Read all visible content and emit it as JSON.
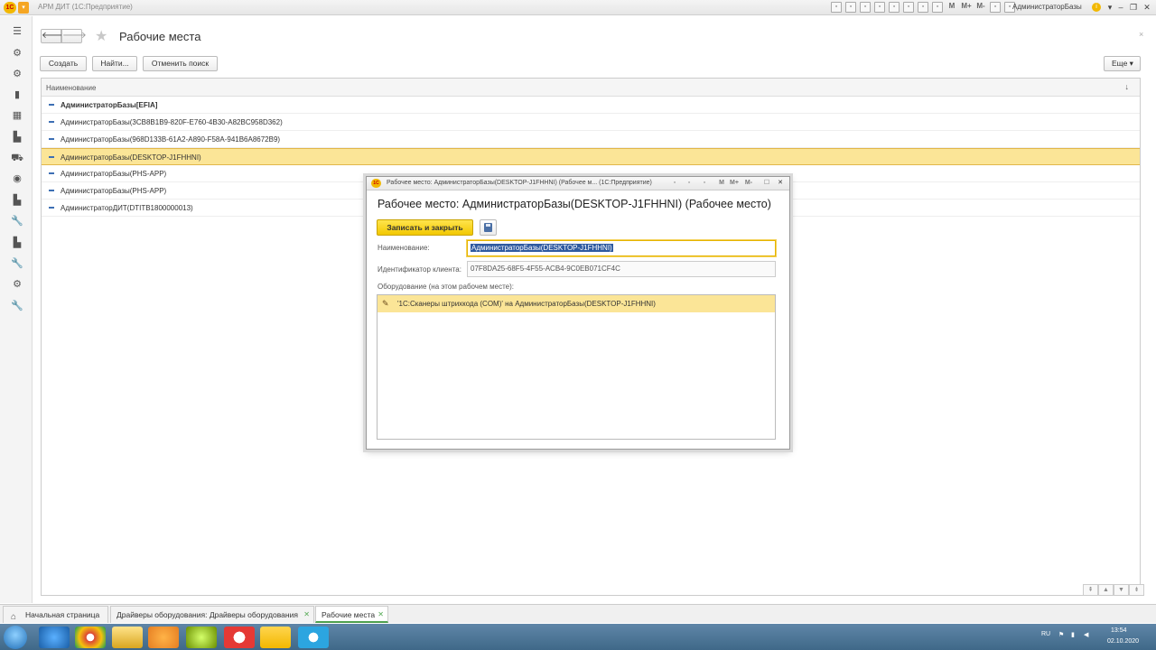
{
  "window": {
    "title": "АРМ ДИТ  (1С:Предприятие)",
    "user": "АдминистраторБазы",
    "toolbar_items": [
      "M",
      "M+",
      "M-"
    ]
  },
  "page": {
    "title": "Рабочие места",
    "buttons": {
      "create": "Создать",
      "find": "Найти...",
      "cancel_search": "Отменить поиск",
      "more": "Еще"
    }
  },
  "table": {
    "column_header": "Наименование",
    "rows": [
      {
        "name": "АдминистраторБазы[EFIA]",
        "bold": true,
        "selected": false
      },
      {
        "name": "АдминистраторБазы(3CB8B1B9-820F-E760-4B30-A82BC958D362)",
        "bold": false,
        "selected": false
      },
      {
        "name": "АдминистраторБазы(968D133B-61A2-A890-F58A-941B6A8672B9)",
        "bold": false,
        "selected": false
      },
      {
        "name": "АдминистраторБазы(DESKTOP-J1FHHNI)",
        "bold": false,
        "selected": true
      },
      {
        "name": "АдминистраторБазы(PHS-APP)",
        "bold": false,
        "selected": false
      },
      {
        "name": "АдминистраторБазы(PHS-APP)",
        "bold": false,
        "selected": false
      },
      {
        "name": "АдминистраторДИТ(DTITB1800000013)",
        "bold": false,
        "selected": false
      }
    ]
  },
  "tabs": [
    {
      "label": "Начальная страница"
    },
    {
      "label": "Драйверы оборудования: Драйверы оборудования"
    },
    {
      "label": "Рабочие места"
    }
  ],
  "dialog": {
    "window_title": "Рабочее место: АдминистраторБазы(DESKTOP-J1FHHNI) (Рабочее м...  (1С:Предприятие)",
    "toolbar_items": [
      "M",
      "M+",
      "M-"
    ],
    "heading": "Рабочее место: АдминистраторБазы(DESKTOP-J1FHHNI) (Рабочее место)",
    "save_close_label": "Записать и закрыть",
    "name_label": "Наименование:",
    "name_value": "АдминистраторБазы(DESKTOP-J1FHHNI)",
    "client_id_label": "Идентификатор клиента:",
    "client_id_value": "07F8DA25-68F5-4F55-ACB4-9C0EB071CF4C",
    "equipment_label": "Оборудование (на этом рабочем месте):",
    "equipment": [
      "'1С:Сканеры штрихкода (COM)' на АдминистраторБазы(DESKTOP-J1FHHNI)"
    ]
  },
  "taskbar": {
    "lang": "RU",
    "time": "13:54",
    "date": "02.10.2020"
  },
  "colors": {
    "selection": "#fbe597",
    "accent_yellow": "#f2c800",
    "row_icon": "#3d6fb4",
    "active_tab_underline": "#4ea04e"
  }
}
